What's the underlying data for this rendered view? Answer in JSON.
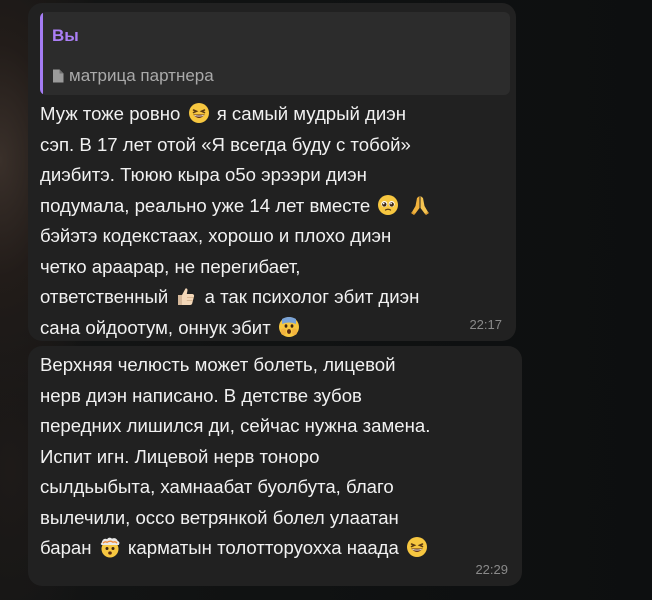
{
  "message1": {
    "reply": {
      "author": "Вы",
      "quote": "матрица партнера"
    },
    "lines": [
      [
        "Муж тоже ровно ",
        "emoji:grin",
        " я самый мудрый диэн"
      ],
      [
        "сэп. В 17 лет отой «Я всегда буду с тобой»"
      ],
      [
        "диэбитэ. Тююю кыра о5о эрээри диэн"
      ],
      [
        "подумала, реально уже 14 лет вместе ",
        "emoji:pleading",
        " ",
        "emoji:pray"
      ],
      [
        "бэйэтэ кодекстаах, хорошо и плохо диэн"
      ],
      [
        "четко араарар, не перегибает,"
      ],
      [
        "ответственный ",
        "emoji:thumbsup",
        " а так психолог эбит диэн"
      ],
      [
        "сана ойдоотум, оннук эбит ",
        "emoji:fearful"
      ]
    ],
    "time": "22:17"
  },
  "message2": {
    "lines": [
      [
        "Верхняя челюсть может болеть, лицевой"
      ],
      [
        "нерв диэн написано. В детстве зубов"
      ],
      [
        "передних лишился ди, сейчас нужна замена."
      ],
      [
        "Испит игн. Лицевой нерв тоноро"
      ],
      [
        "сылдьыбыта, хамнаабат буолбута, благо"
      ],
      [
        "вылечили, оссо ветрянкой болел улаатан"
      ],
      [
        "баран ",
        "emoji:exploding",
        " карматын толотторуохха наада ",
        "emoji:grin"
      ]
    ],
    "time": "22:29"
  },
  "colors": {
    "bubble": "#212121",
    "reply_accent": "#a47cf3",
    "timestamp": "#8a8a8a"
  }
}
